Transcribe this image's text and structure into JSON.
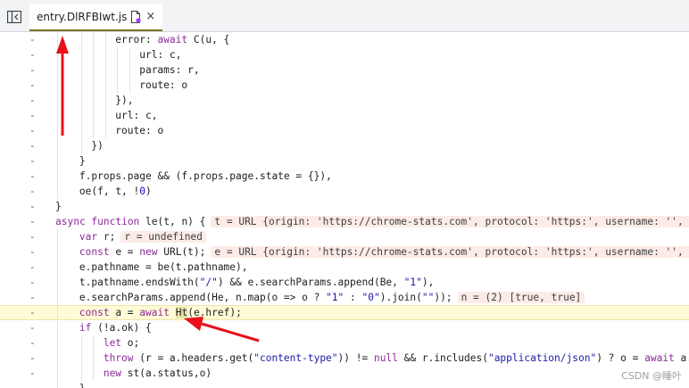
{
  "tab": {
    "filename": "entry.DlRFBIwt.js",
    "close_glyph": "×"
  },
  "watermark": "CSDN @睡叶",
  "colors": {
    "keyword": "#8e2a99",
    "string": "#1a1aa6",
    "number": "#1c00cf",
    "inline_value_bg": "#fcebe6",
    "current_line_bg": "#fefbd6",
    "annotation_arrow": "#e8101a"
  },
  "code_lines": [
    {
      "gutter": "-",
      "indent": 10,
      "parts": [
        [
          "nm",
          "error: "
        ],
        [
          "kw",
          "await"
        ],
        [
          "nm",
          " C(u, {"
        ]
      ]
    },
    {
      "gutter": "-",
      "indent": 14,
      "parts": [
        [
          "nm",
          "url: c,"
        ]
      ]
    },
    {
      "gutter": "-",
      "indent": 14,
      "parts": [
        [
          "nm",
          "params: r,"
        ]
      ]
    },
    {
      "gutter": "-",
      "indent": 14,
      "parts": [
        [
          "nm",
          "route: o"
        ]
      ]
    },
    {
      "gutter": "-",
      "indent": 10,
      "parts": [
        [
          "nm",
          "}),"
        ]
      ]
    },
    {
      "gutter": "-",
      "indent": 10,
      "parts": [
        [
          "nm",
          "url: c,"
        ]
      ]
    },
    {
      "gutter": "-",
      "indent": 10,
      "parts": [
        [
          "nm",
          "route: o"
        ]
      ]
    },
    {
      "gutter": "-",
      "indent": 6,
      "parts": [
        [
          "nm",
          "})"
        ]
      ]
    },
    {
      "gutter": "-",
      "indent": 4,
      "parts": [
        [
          "nm",
          "}"
        ]
      ]
    },
    {
      "gutter": "-",
      "indent": 4,
      "parts": [
        [
          "nm",
          "f.props.page && (f.props.page.state = {}),"
        ]
      ]
    },
    {
      "gutter": "-",
      "indent": 4,
      "parts": [
        [
          "nm",
          "oe(f, t, !"
        ],
        [
          "num",
          "0"
        ],
        [
          "nm",
          ")"
        ]
      ]
    },
    {
      "gutter": "-",
      "indent": 0,
      "parts": [
        [
          "nm",
          "}"
        ]
      ]
    },
    {
      "gutter": "-",
      "indent": 0,
      "parts": [
        [
          "kw",
          "async function"
        ],
        [
          "nm",
          " le(t, n) {"
        ]
      ],
      "inline": "t = URL {origin: 'https://chrome-stats.com', protocol: 'https:', username: '', pa"
    },
    {
      "gutter": "-",
      "indent": 4,
      "parts": [
        [
          "kw",
          "var"
        ],
        [
          "nm",
          " r;"
        ]
      ],
      "inline": "r = undefined"
    },
    {
      "gutter": "-",
      "indent": 4,
      "parts": [
        [
          "kw",
          "const"
        ],
        [
          "nm",
          " e = "
        ],
        [
          "kw",
          "new"
        ],
        [
          "nm",
          " URL(t);"
        ]
      ],
      "inline": "e = URL {origin: 'https://chrome-stats.com', protocol: 'https:', username: '', pa"
    },
    {
      "gutter": "-",
      "indent": 4,
      "parts": [
        [
          "nm",
          "e.pathname = be(t.pathname),"
        ]
      ]
    },
    {
      "gutter": "-",
      "indent": 4,
      "parts": [
        [
          "nm",
          "t.pathname.endsWith("
        ],
        [
          "str",
          "\"/\""
        ],
        [
          "nm",
          ") && e.searchParams.append(Be, "
        ],
        [
          "str",
          "\"1\""
        ],
        [
          "nm",
          "),"
        ]
      ]
    },
    {
      "gutter": "-",
      "indent": 4,
      "parts": [
        [
          "nm",
          "e.searchParams.append(He, n.map(o => o ? "
        ],
        [
          "str",
          "\"1\""
        ],
        [
          "nm",
          " : "
        ],
        [
          "str",
          "\"0\""
        ],
        [
          "nm",
          ").join("
        ],
        [
          "str",
          "\"\""
        ],
        [
          "nm",
          "));"
        ]
      ],
      "inline": "n = (2) [true, true]"
    },
    {
      "gutter": "-",
      "indent": 4,
      "highlight": true,
      "parts": [
        [
          "kw",
          "const"
        ],
        [
          "nm",
          " a = "
        ],
        [
          "kw",
          "await"
        ],
        [
          "nm",
          " "
        ],
        [
          "hl",
          "Ht"
        ],
        [
          "nm",
          "(e.href);"
        ]
      ]
    },
    {
      "gutter": "-",
      "indent": 4,
      "parts": [
        [
          "kw",
          "if"
        ],
        [
          "nm",
          " (!a.ok) {"
        ]
      ]
    },
    {
      "gutter": "-",
      "indent": 8,
      "parts": [
        [
          "kw",
          "let"
        ],
        [
          "nm",
          " o;"
        ]
      ]
    },
    {
      "gutter": "-",
      "indent": 8,
      "parts": [
        [
          "kw",
          "throw"
        ],
        [
          "nm",
          " (r = a.headers.get("
        ],
        [
          "str",
          "\"content-type\""
        ],
        [
          "nm",
          ")) != "
        ],
        [
          "kw",
          "null"
        ],
        [
          "nm",
          " && r.includes("
        ],
        [
          "str",
          "\"application/json\""
        ],
        [
          "nm",
          ") ? o = "
        ],
        [
          "kw",
          "await"
        ],
        [
          "nm",
          " a.js"
        ]
      ]
    },
    {
      "gutter": "-",
      "indent": 8,
      "parts": [
        [
          "kw",
          "new"
        ],
        [
          "nm",
          " st(a.status,o)"
        ]
      ]
    },
    {
      "gutter": "-",
      "indent": 4,
      "parts": [
        [
          "nm",
          "}"
        ]
      ]
    }
  ]
}
